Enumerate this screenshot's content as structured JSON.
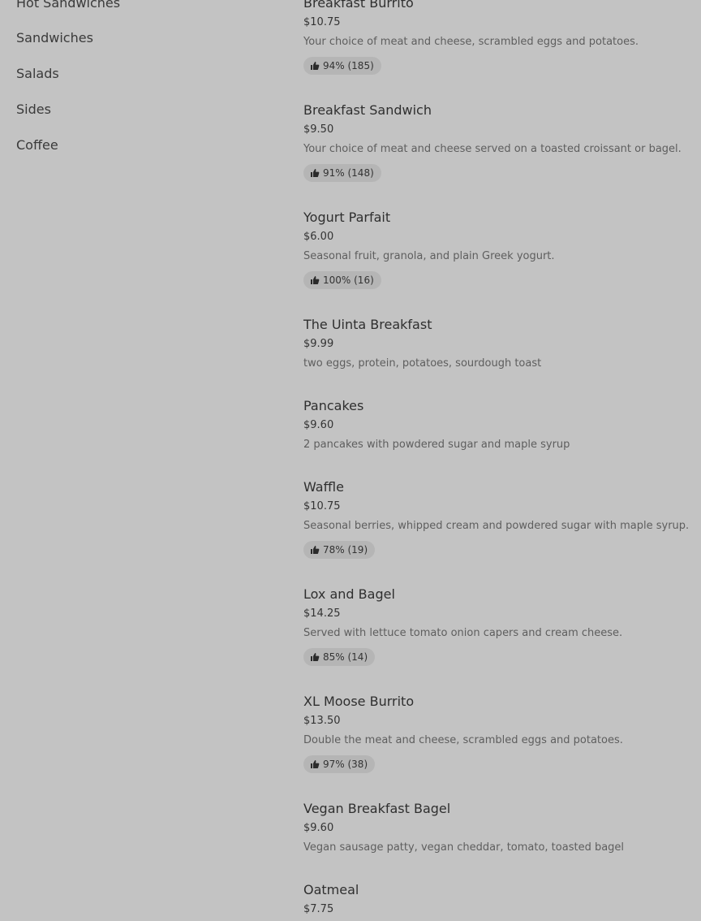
{
  "categories": [
    {
      "label": "Hot Sandwiches"
    },
    {
      "label": "Sandwiches"
    },
    {
      "label": "Salads"
    },
    {
      "label": "Sides"
    },
    {
      "label": "Coffee"
    }
  ],
  "items": [
    {
      "name": "Breakfast Burrito",
      "price": "$10.75",
      "description": "Your choice of meat and cheese, scrambled eggs and potatoes.",
      "rating": "94% (185)"
    },
    {
      "name": "Breakfast Sandwich",
      "price": "$9.50",
      "description": "Your choice of meat and cheese served on a toasted croissant or bagel.",
      "rating": "91% (148)"
    },
    {
      "name": "Yogurt Parfait",
      "price": "$6.00",
      "description": "Seasonal fruit, granola, and plain Greek yogurt.",
      "rating": "100% (16)"
    },
    {
      "name": "The Uinta Breakfast",
      "price": "$9.99",
      "description": "two eggs, protein, potatoes, sourdough toast"
    },
    {
      "name": "Pancakes",
      "price": "$9.60",
      "description": "2 pancakes with powdered sugar and maple syrup"
    },
    {
      "name": "Waffle",
      "price": "$10.75",
      "description": "Seasonal berries, whipped cream and powdered sugar with maple syrup.",
      "rating": "78% (19)"
    },
    {
      "name": "Lox and Bagel",
      "price": "$14.25",
      "description": "Served with lettuce tomato onion capers and cream cheese.",
      "rating": "85% (14)"
    },
    {
      "name": "XL Moose Burrito",
      "price": "$13.50",
      "description": "Double the meat and cheese, scrambled eggs and potatoes.",
      "rating": "97% (38)"
    },
    {
      "name": "Vegan Breakfast Bagel",
      "price": "$9.60",
      "description": "Vegan sausage patty, vegan cheddar, tomato, toasted bagel"
    },
    {
      "name": "Oatmeal",
      "price": "$7.75"
    }
  ]
}
